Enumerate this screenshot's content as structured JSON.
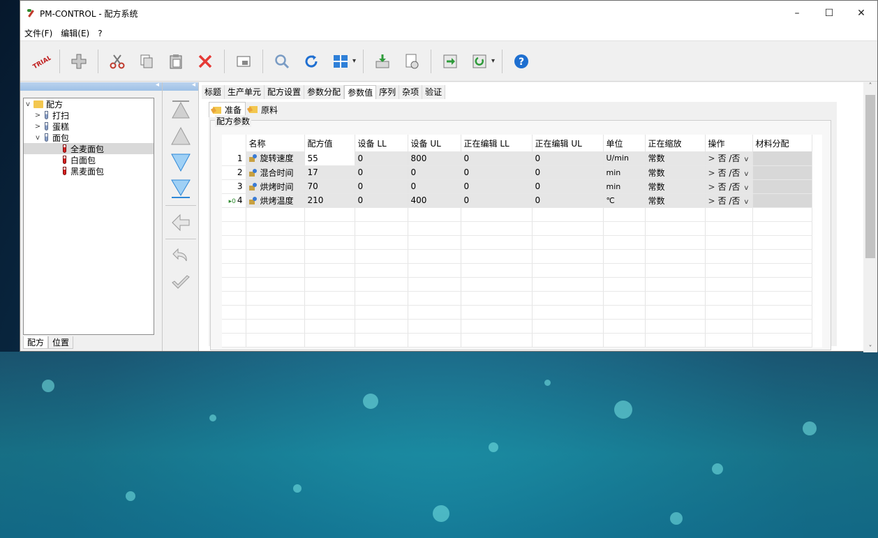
{
  "window": {
    "title": "PM-CONTROL - 配方系统",
    "controls": {
      "minimize": "–",
      "maximize": "☐",
      "close": "✕"
    }
  },
  "menu": [
    "文件(F)",
    "编辑(E)",
    "?"
  ],
  "toolbar": {
    "trial_label": "TRIAL",
    "buttons": [
      "trial-icon",
      "add-icon",
      "cut-icon",
      "copy-icon",
      "paste-icon",
      "delete-icon",
      "preview-icon",
      "search-icon",
      "refresh-icon",
      "grid-view-icon",
      "download-icon",
      "report-icon",
      "export-icon",
      "import-icon",
      "help-icon"
    ]
  },
  "tree": {
    "root": "配方",
    "items": [
      {
        "label": "打扫",
        "level": 1,
        "expander": ">"
      },
      {
        "label": "蛋糕",
        "level": 1,
        "expander": ">"
      },
      {
        "label": "面包",
        "level": 1,
        "expander": "v"
      },
      {
        "label": "全麦面包",
        "level": 2,
        "selected": true
      },
      {
        "label": "白面包",
        "level": 2
      },
      {
        "label": "黑麦面包",
        "level": 2
      }
    ],
    "tabs": [
      "配方",
      "位置"
    ]
  },
  "tabs": [
    "标题",
    "生产单元",
    "配方设置",
    "参数分配",
    "参数值",
    "序列",
    "杂项",
    "验证"
  ],
  "active_tab": "参数值",
  "subtabs": [
    "准备",
    "原料"
  ],
  "group_label": "配方参数",
  "columns": [
    "",
    "名称",
    "配方值",
    "设备 LL",
    "设备 UL",
    "正在编辑 LL",
    "正在编辑 UL",
    "单位",
    "正在缩放",
    "操作",
    "材料分配"
  ],
  "rows": [
    {
      "n": "1",
      "name": "旋转速度",
      "value": "55",
      "ll": "0",
      "ul": "800",
      "ell": "0",
      "eul": "0",
      "unit": "U/min",
      "scale": "常数",
      "op": "否 /否"
    },
    {
      "n": "2",
      "name": "混合时间",
      "value": "17",
      "ll": "0",
      "ul": "0",
      "ell": "0",
      "eul": "0",
      "unit": "min",
      "scale": "常数",
      "op": "否 /否"
    },
    {
      "n": "3",
      "name": "烘烤时间",
      "value": "70",
      "ll": "0",
      "ul": "0",
      "ell": "0",
      "eul": "0",
      "unit": "min",
      "scale": "常数",
      "op": "否 /否"
    },
    {
      "n": "4",
      "name": "烘烤温度",
      "value": "210",
      "ll": "0",
      "ul": "400",
      "ell": "0",
      "eul": "0",
      "unit": "℃",
      "scale": "常数",
      "op": "否 /否"
    }
  ],
  "colors": {
    "selection": "#d9d9d9",
    "pane_header": "#a9c8ea",
    "accent": "#3a7bd5"
  }
}
